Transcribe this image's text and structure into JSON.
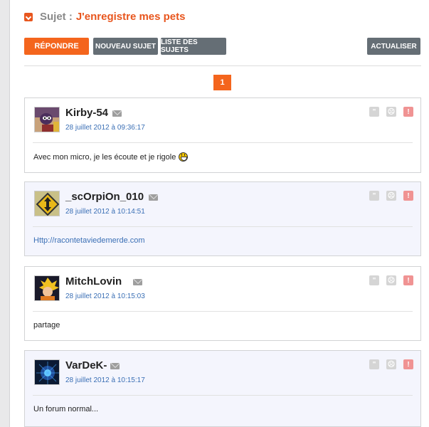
{
  "header": {
    "collapse_icon": "chevron-down-icon",
    "prefix": "Sujet :",
    "title": "J'enregistre mes pets"
  },
  "toolbar": {
    "reply_label": "RÉPONDRE",
    "new_topic_label": "NOUVEAU SUJET",
    "topic_list_label": "LISTE DES SUJETS",
    "refresh_label": "ACTUALISER"
  },
  "pagination": {
    "current_page": "1"
  },
  "colors": {
    "accent": "#f4651d",
    "button_gray": "#656e75",
    "link": "#3a6fb5",
    "alt_post_bg": "#f4f5fd"
  },
  "posts": [
    {
      "author": "Kirby-54",
      "date": "28 juillet 2012 à 09:36:17",
      "body": "Avec mon micro, je les écoute et je rigole",
      "body_icon": "laughing-smiley-icon"
    },
    {
      "author": "_scOrpiOn_010",
      "date": "28 juillet 2012 à 10:14:51",
      "body": "Http://racontetaviedemerde.com"
    },
    {
      "author": "MitchLovin",
      "date": "28 juillet 2012 à 10:15:03",
      "body": "partage"
    },
    {
      "author": "VarDeK-",
      "date": "28 juillet 2012 à 10:15:17",
      "body": "Un forum normal..."
    }
  ]
}
